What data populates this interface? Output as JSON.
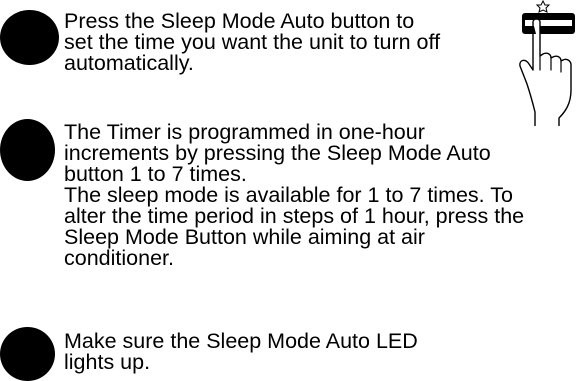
{
  "steps": [
    {
      "lines": [
        "Press the Sleep Mode Auto button to",
        "set the time you want the unit to turn off",
        "automatically."
      ]
    },
    {
      "lines": [
        "The Timer is programmed in one-hour",
        "increments by pressing the Sleep Mode Auto",
        "button 1 to 7 times.",
        "The sleep mode is available for 1 to 7 times. To",
        "alter the time period in steps of 1 hour, press the",
        "Sleep Mode Button while aiming at air",
        "conditioner."
      ]
    },
    {
      "lines": [
        "Make sure the Sleep Mode Auto LED",
        "lights up."
      ]
    }
  ],
  "illustration": {
    "icon": "hand-pressing-button-icon"
  }
}
